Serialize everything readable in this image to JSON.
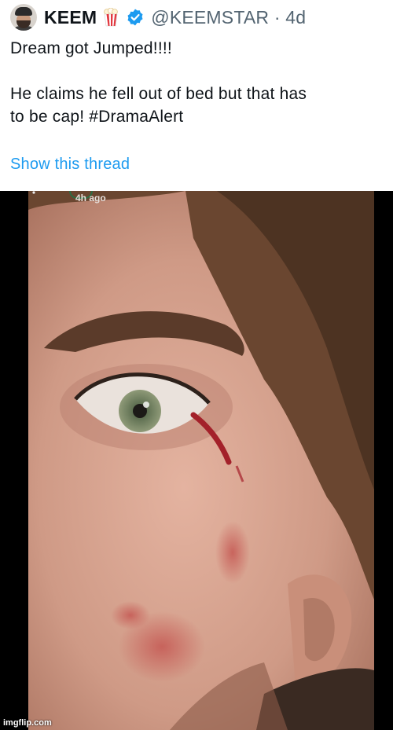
{
  "tweet": {
    "display_name": "KEEM",
    "name_emoji": "popcorn-icon",
    "verified_badge": "verified-icon",
    "handle": "@KEEMSTAR",
    "separator": "·",
    "age": "4d",
    "text_line_1": "Dream got Jumped!!!!",
    "text_line_2": "He claims he fell out of bed but that has",
    "text_line_3": "to be cap! #DramaAlert",
    "show_thread": "Show this thread",
    "link_color": "#1d9bf0"
  },
  "photo": {
    "description_icon": "face-closeup-photo",
    "story_time": "4h ago",
    "watermark": "imgflip.com"
  }
}
